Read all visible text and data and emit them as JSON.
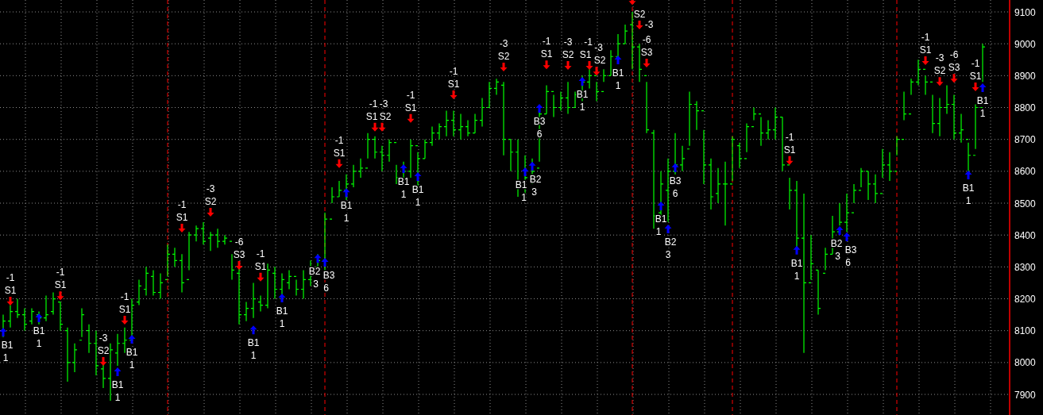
{
  "price_axis": {
    "labels": [
      "9100",
      "9000",
      "8900",
      "8800",
      "8700",
      "8600",
      "8500",
      "8400",
      "8300",
      "8200",
      "8100",
      "8000",
      "7900"
    ]
  },
  "signals": [
    {
      "kind": "sell",
      "label": "S1",
      "size": "-1"
    },
    {
      "kind": "sell",
      "label": "S1",
      "size": "-1"
    },
    {
      "kind": "sell",
      "label": "S2",
      "size": "-3"
    },
    {
      "kind": "sell",
      "label": "S1",
      "size": "-1"
    },
    {
      "kind": "sell",
      "label": "S1",
      "size": "-1"
    },
    {
      "kind": "sell",
      "label": "S2",
      "size": "-3"
    },
    {
      "kind": "sell",
      "label": "S3",
      "size": "-6"
    },
    {
      "kind": "sell",
      "label": "S1",
      "size": "-1"
    },
    {
      "kind": "sell",
      "label": "S1",
      "size": "-1"
    },
    {
      "kind": "sell",
      "label": "S1",
      "size": "-1"
    },
    {
      "kind": "sell",
      "label": "S2",
      "size": "-3"
    },
    {
      "kind": "sell",
      "label": "S1",
      "size": "-1"
    },
    {
      "kind": "sell",
      "label": "S1",
      "size": "-1"
    },
    {
      "kind": "sell",
      "label": "S2",
      "size": "-3"
    },
    {
      "kind": "sell",
      "label": "S1",
      "size": "-1"
    },
    {
      "kind": "sell",
      "label": "S2",
      "size": "-3"
    },
    {
      "kind": "sell",
      "label": "S1",
      "size": "-1"
    },
    {
      "kind": "sell",
      "label": "S2",
      "size": "-3"
    },
    {
      "kind": "sell"
    },
    {
      "kind": "sell",
      "label": "S2",
      "size": "-3"
    },
    {
      "kind": "sell",
      "label": "S3",
      "size": "-6"
    },
    {
      "kind": "sell",
      "label": "S1",
      "size": "-1"
    },
    {
      "kind": "sell",
      "label": "S1",
      "size": "-1"
    },
    {
      "kind": "sell",
      "label": "S2",
      "size": "-3"
    },
    {
      "kind": "sell",
      "label": "S3",
      "size": "-6"
    },
    {
      "kind": "sell",
      "label": "S1",
      "size": "-1"
    },
    {
      "kind": "buy",
      "label": "B1",
      "size": "1"
    },
    {
      "kind": "buy",
      "label": "B1",
      "size": "1"
    },
    {
      "kind": "buy",
      "label": "B1",
      "size": "1"
    },
    {
      "kind": "buy",
      "label": "B1",
      "size": "1"
    },
    {
      "kind": "buy",
      "label": "B1",
      "size": "1"
    },
    {
      "kind": "buy",
      "label": "B1",
      "size": "1"
    },
    {
      "kind": "buy",
      "label": "B2",
      "size": "3"
    },
    {
      "kind": "buy",
      "label": "B3",
      "size": "6"
    },
    {
      "kind": "buy",
      "label": "B1",
      "size": "1"
    },
    {
      "kind": "buy",
      "label": "B1",
      "size": "1"
    },
    {
      "kind": "buy",
      "label": "B1",
      "size": "1"
    },
    {
      "kind": "buy",
      "label": "B1",
      "size": "1"
    },
    {
      "kind": "buy",
      "label": "B2",
      "size": "3"
    },
    {
      "kind": "buy",
      "label": "B3",
      "size": "6"
    },
    {
      "kind": "buy",
      "label": "B1",
      "size": "1"
    },
    {
      "kind": "buy",
      "label": "B1",
      "size": "1"
    },
    {
      "kind": "buy",
      "label": "B1",
      "size": "1"
    },
    {
      "kind": "buy",
      "label": "B2",
      "size": "3"
    },
    {
      "kind": "buy",
      "label": "B3",
      "size": "6"
    },
    {
      "kind": "buy",
      "label": "B1",
      "size": "1"
    },
    {
      "kind": "buy",
      "label": "B2",
      "size": "3"
    },
    {
      "kind": "buy",
      "label": "B3",
      "size": "6"
    },
    {
      "kind": "buy",
      "label": "B1",
      "size": "1"
    },
    {
      "kind": "buy",
      "label": "B1",
      "size": "1"
    }
  ]
}
